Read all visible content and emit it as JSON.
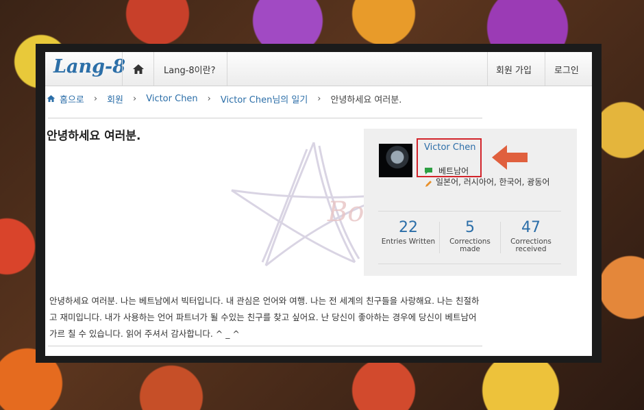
{
  "header": {
    "logo": "Lang-8",
    "about_link": "Lang-8이란?",
    "signup_link": "회원 가입",
    "login_link": "로그인"
  },
  "breadcrumb": [
    {
      "label": "홈으로"
    },
    {
      "label": "회원"
    },
    {
      "label": "Victor Chen"
    },
    {
      "label": "Victor Chen님의 일기"
    },
    {
      "label": "안녕하세요 여러분."
    }
  ],
  "entry": {
    "title": "안녕하세요 여러분.",
    "body": "안녕하세요 여러분. 나는 베트남에서 빅터입니다. 내 관심은 언어와 여행. 나는 전 세계의 친구들을 사랑해요. 나는 친절하고 재미입니다. 내가 사용하는 언어 파트너가 될 수있는 친구를 찾고 싶어요. 난 당신이 좋아하는 경우에 당신이 베트남어 가르 칠 수 있습니다. 읽어 주셔서 감사합니다. ^ _ ^",
    "watermark_text": "Book"
  },
  "profile": {
    "name": "Victor Chen",
    "native_language": "베트남어",
    "learning_languages": "일본어, 러시아어, 한국어, 광동어",
    "stats": [
      {
        "value": "22",
        "label": "Entries Written"
      },
      {
        "value": "5",
        "label": "Corrections made"
      },
      {
        "value": "47",
        "label": "Corrections received"
      }
    ]
  },
  "colors": {
    "link": "#2b6ea8",
    "highlight_box": "#d2232a",
    "arrow": "#e0603e",
    "native_icon": "#2ea043",
    "learning_icon": "#e8902a"
  },
  "icons": {
    "home": "home-icon",
    "native": "speech-bubble-icon",
    "learning": "pencil-icon",
    "annotation": "arrow-left-icon"
  }
}
